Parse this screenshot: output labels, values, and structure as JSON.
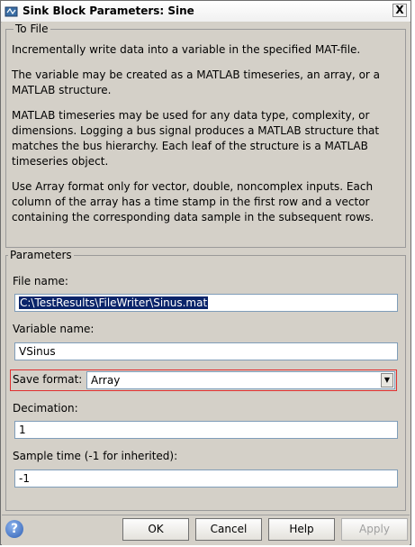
{
  "window": {
    "title": "Sink Block Parameters: Sine",
    "close_glyph": "X"
  },
  "to_file": {
    "group_label": "To File",
    "paragraphs": [
      "Incrementally write data into a variable in the specified MAT-file.",
      "The variable may be created as a MATLAB timeseries, an array, or a MATLAB structure.",
      "MATLAB timeseries may be used for any data type, complexity, or dimensions. Logging a bus signal produces a MATLAB structure that matches the bus hierarchy. Each leaf of the structure is a MATLAB timeseries object.",
      "Use Array format only for vector, double, noncomplex inputs. Each column of the array has a time stamp in the first row and a vector containing the corresponding data sample in the subsequent rows."
    ]
  },
  "parameters": {
    "group_label": "Parameters",
    "file_name": {
      "label": "File name:",
      "value": "C:\\TestResults\\FileWriter\\Sinus.mat"
    },
    "variable_name": {
      "label": "Variable name:",
      "value": "VSinus"
    },
    "save_format": {
      "label": "Save format:",
      "value": "Array"
    },
    "decimation": {
      "label": "Decimation:",
      "value": "1"
    },
    "sample_time": {
      "label": "Sample time (-1 for inherited):",
      "value": "-1"
    }
  },
  "buttons": {
    "help_glyph": "?",
    "ok": "OK",
    "cancel": "Cancel",
    "help": "Help",
    "apply": "Apply"
  },
  "icons": {
    "app": "simulink-block-icon",
    "help": "help-question-icon",
    "dropdown": "chevron-down-icon"
  }
}
